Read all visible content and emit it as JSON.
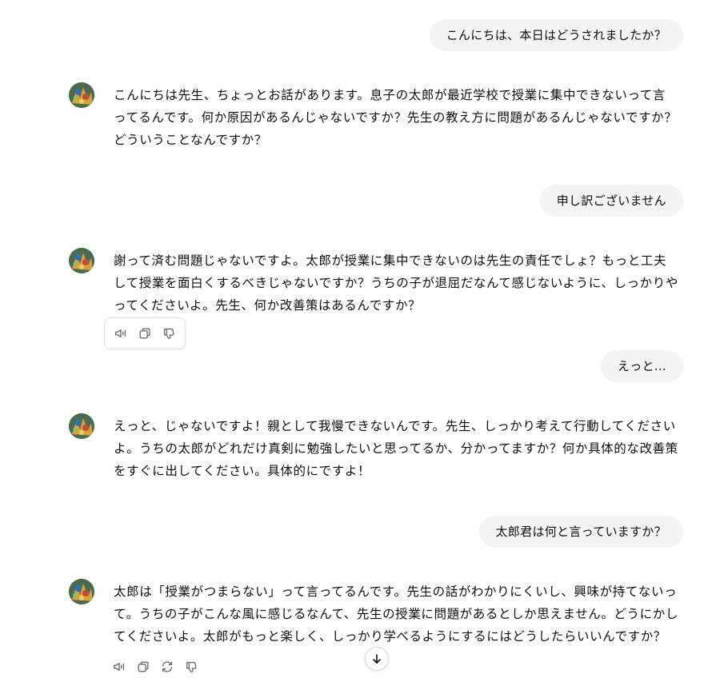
{
  "messages": [
    {
      "role": "user",
      "text": "こんにちは、本日はどうされましたか？"
    },
    {
      "role": "assistant",
      "text": "こんにちは先生、ちょっとお話があります。息子の太郎が最近学校で授業に集中できないって言ってるんです。何か原因があるんじゃないですか？先生の教え方に問題があるんじゃないですか？どういうことなんですか？"
    },
    {
      "role": "user",
      "text": "申し訳ございません"
    },
    {
      "role": "assistant",
      "text": "謝って済む問題じゃないですよ。太郎が授業に集中できないのは先生の責任でしょ？もっと工夫して授業を面白くするべきじゃないですか？うちの子が退屈だなんて感じないように、しっかりやってくださいよ。先生、何か改善策はあるんですか？"
    },
    {
      "role": "user",
      "text": "えっと..."
    },
    {
      "role": "assistant",
      "text": "えっと、じゃないですよ！親として我慢できないんです。先生、しっかり考えて行動してくださいよ。うちの太郎がどれだけ真剣に勉強したいと思ってるか、分かってますか？何か具体的な改善策をすぐに出してください。具体的にですよ！"
    },
    {
      "role": "user",
      "text": "太郎君は何と言っていますか？"
    },
    {
      "role": "assistant",
      "text": "太郎は「授業がつまらない」って言ってるんです。先生の話がわかりにくいし、興味が持てないって。うちの子がこんな風に感じるなんて、先生の授業に問題があるとしか思えません。どうにかしてくださいよ。太郎がもっと楽しく、しっかり学べるようにするにはどうしたらいいんですか？"
    }
  ],
  "action_icons": {
    "hover_toolbar": [
      "speaker-icon",
      "copy-icon",
      "thumbs-down-icon"
    ],
    "last_toolbar": [
      "speaker-icon",
      "copy-icon",
      "regenerate-icon",
      "thumbs-down-icon"
    ]
  },
  "scroll_button_icon": "arrow-down-icon",
  "colors": {
    "user_bubble_bg": "#f4f4f4",
    "text": "#0d0d0d",
    "icon": "#6b6b6b"
  }
}
